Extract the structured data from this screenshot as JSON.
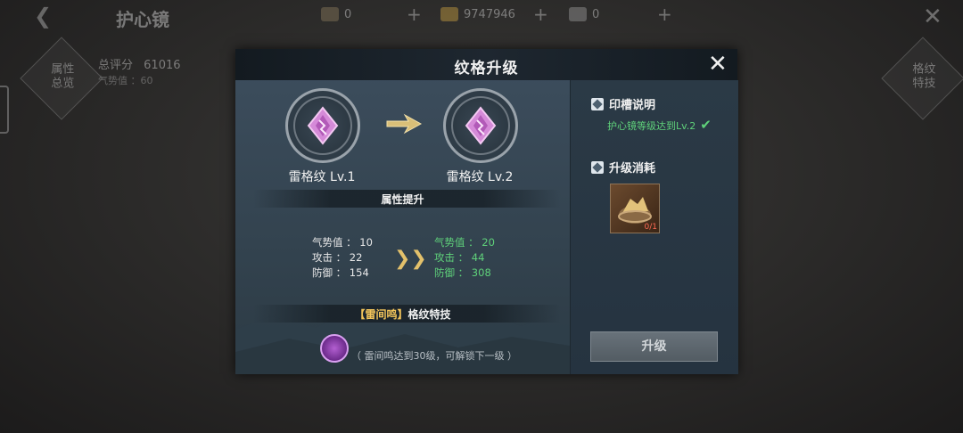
{
  "background": {
    "title": "护心镜",
    "resources": [
      {
        "icon": "scroll-icon",
        "value": "0",
        "color": "#8a7a5a"
      },
      {
        "icon": "gold-ingot-icon",
        "value": "9747946",
        "color": "#c9a040"
      },
      {
        "icon": "silver-ingot-icon",
        "value": "0",
        "color": "#9a9a9a"
      }
    ],
    "left_button": "属性\n总览",
    "right_button": "格纹\n特技",
    "score_label": "总评分",
    "score_value": "61016",
    "score_sub": "气势值 ：60"
  },
  "dialog": {
    "title": "纹格升级",
    "current_rune": "雷格纹 Lv.1",
    "next_rune": "雷格纹 Lv.2",
    "attr_section_title": "属性提升",
    "stats_current": [
      "气势值 ： 10",
      "攻击 ： 22",
      "防御 ： 154"
    ],
    "stats_next": [
      "气势值 ： 20",
      "攻击 ： 44",
      "防御 ： 308"
    ],
    "skill_tag": "【雷间鸣】",
    "skill_title": "格纹特技",
    "skill_note": "（ 雷间鸣达到30级，可解锁下一级 ）",
    "slot_section": "印槽说明",
    "slot_requirement": "护心镜等级达到Lv.2",
    "cost_section": "升级消耗",
    "cost_item_count": "0/1",
    "upgrade_button": "升级"
  },
  "colors": {
    "accent_green": "#5fd17a",
    "gold_tag": "#f1c35a",
    "rune_purple": "#d58ad8"
  }
}
